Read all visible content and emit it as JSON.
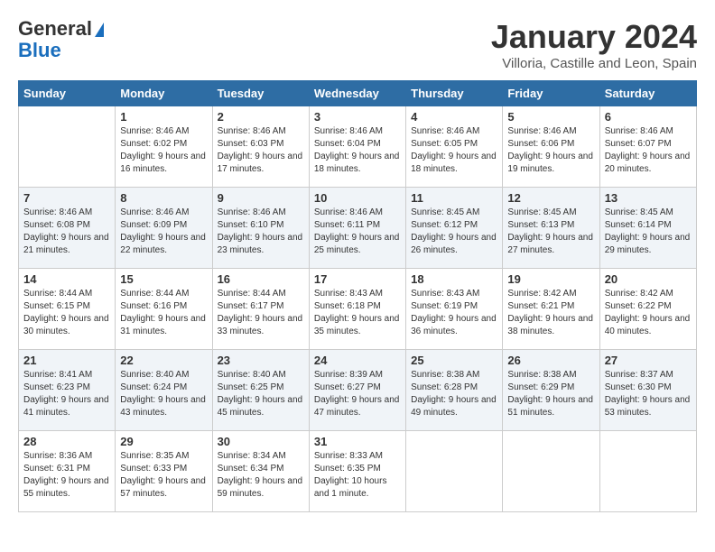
{
  "header": {
    "logo_general": "General",
    "logo_blue": "Blue",
    "month": "January 2024",
    "location": "Villoria, Castille and Leon, Spain"
  },
  "days_of_week": [
    "Sunday",
    "Monday",
    "Tuesday",
    "Wednesday",
    "Thursday",
    "Friday",
    "Saturday"
  ],
  "weeks": [
    [
      {
        "day": "",
        "sunrise": "",
        "sunset": "",
        "daylight": ""
      },
      {
        "day": "1",
        "sunrise": "Sunrise: 8:46 AM",
        "sunset": "Sunset: 6:02 PM",
        "daylight": "Daylight: 9 hours and 16 minutes."
      },
      {
        "day": "2",
        "sunrise": "Sunrise: 8:46 AM",
        "sunset": "Sunset: 6:03 PM",
        "daylight": "Daylight: 9 hours and 17 minutes."
      },
      {
        "day": "3",
        "sunrise": "Sunrise: 8:46 AM",
        "sunset": "Sunset: 6:04 PM",
        "daylight": "Daylight: 9 hours and 18 minutes."
      },
      {
        "day": "4",
        "sunrise": "Sunrise: 8:46 AM",
        "sunset": "Sunset: 6:05 PM",
        "daylight": "Daylight: 9 hours and 18 minutes."
      },
      {
        "day": "5",
        "sunrise": "Sunrise: 8:46 AM",
        "sunset": "Sunset: 6:06 PM",
        "daylight": "Daylight: 9 hours and 19 minutes."
      },
      {
        "day": "6",
        "sunrise": "Sunrise: 8:46 AM",
        "sunset": "Sunset: 6:07 PM",
        "daylight": "Daylight: 9 hours and 20 minutes."
      }
    ],
    [
      {
        "day": "7",
        "sunrise": "Sunrise: 8:46 AM",
        "sunset": "Sunset: 6:08 PM",
        "daylight": "Daylight: 9 hours and 21 minutes."
      },
      {
        "day": "8",
        "sunrise": "Sunrise: 8:46 AM",
        "sunset": "Sunset: 6:09 PM",
        "daylight": "Daylight: 9 hours and 22 minutes."
      },
      {
        "day": "9",
        "sunrise": "Sunrise: 8:46 AM",
        "sunset": "Sunset: 6:10 PM",
        "daylight": "Daylight: 9 hours and 23 minutes."
      },
      {
        "day": "10",
        "sunrise": "Sunrise: 8:46 AM",
        "sunset": "Sunset: 6:11 PM",
        "daylight": "Daylight: 9 hours and 25 minutes."
      },
      {
        "day": "11",
        "sunrise": "Sunrise: 8:45 AM",
        "sunset": "Sunset: 6:12 PM",
        "daylight": "Daylight: 9 hours and 26 minutes."
      },
      {
        "day": "12",
        "sunrise": "Sunrise: 8:45 AM",
        "sunset": "Sunset: 6:13 PM",
        "daylight": "Daylight: 9 hours and 27 minutes."
      },
      {
        "day": "13",
        "sunrise": "Sunrise: 8:45 AM",
        "sunset": "Sunset: 6:14 PM",
        "daylight": "Daylight: 9 hours and 29 minutes."
      }
    ],
    [
      {
        "day": "14",
        "sunrise": "Sunrise: 8:44 AM",
        "sunset": "Sunset: 6:15 PM",
        "daylight": "Daylight: 9 hours and 30 minutes."
      },
      {
        "day": "15",
        "sunrise": "Sunrise: 8:44 AM",
        "sunset": "Sunset: 6:16 PM",
        "daylight": "Daylight: 9 hours and 31 minutes."
      },
      {
        "day": "16",
        "sunrise": "Sunrise: 8:44 AM",
        "sunset": "Sunset: 6:17 PM",
        "daylight": "Daylight: 9 hours and 33 minutes."
      },
      {
        "day": "17",
        "sunrise": "Sunrise: 8:43 AM",
        "sunset": "Sunset: 6:18 PM",
        "daylight": "Daylight: 9 hours and 35 minutes."
      },
      {
        "day": "18",
        "sunrise": "Sunrise: 8:43 AM",
        "sunset": "Sunset: 6:19 PM",
        "daylight": "Daylight: 9 hours and 36 minutes."
      },
      {
        "day": "19",
        "sunrise": "Sunrise: 8:42 AM",
        "sunset": "Sunset: 6:21 PM",
        "daylight": "Daylight: 9 hours and 38 minutes."
      },
      {
        "day": "20",
        "sunrise": "Sunrise: 8:42 AM",
        "sunset": "Sunset: 6:22 PM",
        "daylight": "Daylight: 9 hours and 40 minutes."
      }
    ],
    [
      {
        "day": "21",
        "sunrise": "Sunrise: 8:41 AM",
        "sunset": "Sunset: 6:23 PM",
        "daylight": "Daylight: 9 hours and 41 minutes."
      },
      {
        "day": "22",
        "sunrise": "Sunrise: 8:40 AM",
        "sunset": "Sunset: 6:24 PM",
        "daylight": "Daylight: 9 hours and 43 minutes."
      },
      {
        "day": "23",
        "sunrise": "Sunrise: 8:40 AM",
        "sunset": "Sunset: 6:25 PM",
        "daylight": "Daylight: 9 hours and 45 minutes."
      },
      {
        "day": "24",
        "sunrise": "Sunrise: 8:39 AM",
        "sunset": "Sunset: 6:27 PM",
        "daylight": "Daylight: 9 hours and 47 minutes."
      },
      {
        "day": "25",
        "sunrise": "Sunrise: 8:38 AM",
        "sunset": "Sunset: 6:28 PM",
        "daylight": "Daylight: 9 hours and 49 minutes."
      },
      {
        "day": "26",
        "sunrise": "Sunrise: 8:38 AM",
        "sunset": "Sunset: 6:29 PM",
        "daylight": "Daylight: 9 hours and 51 minutes."
      },
      {
        "day": "27",
        "sunrise": "Sunrise: 8:37 AM",
        "sunset": "Sunset: 6:30 PM",
        "daylight": "Daylight: 9 hours and 53 minutes."
      }
    ],
    [
      {
        "day": "28",
        "sunrise": "Sunrise: 8:36 AM",
        "sunset": "Sunset: 6:31 PM",
        "daylight": "Daylight: 9 hours and 55 minutes."
      },
      {
        "day": "29",
        "sunrise": "Sunrise: 8:35 AM",
        "sunset": "Sunset: 6:33 PM",
        "daylight": "Daylight: 9 hours and 57 minutes."
      },
      {
        "day": "30",
        "sunrise": "Sunrise: 8:34 AM",
        "sunset": "Sunset: 6:34 PM",
        "daylight": "Daylight: 9 hours and 59 minutes."
      },
      {
        "day": "31",
        "sunrise": "Sunrise: 8:33 AM",
        "sunset": "Sunset: 6:35 PM",
        "daylight": "Daylight: 10 hours and 1 minute."
      },
      {
        "day": "",
        "sunrise": "",
        "sunset": "",
        "daylight": ""
      },
      {
        "day": "",
        "sunrise": "",
        "sunset": "",
        "daylight": ""
      },
      {
        "day": "",
        "sunrise": "",
        "sunset": "",
        "daylight": ""
      }
    ]
  ]
}
